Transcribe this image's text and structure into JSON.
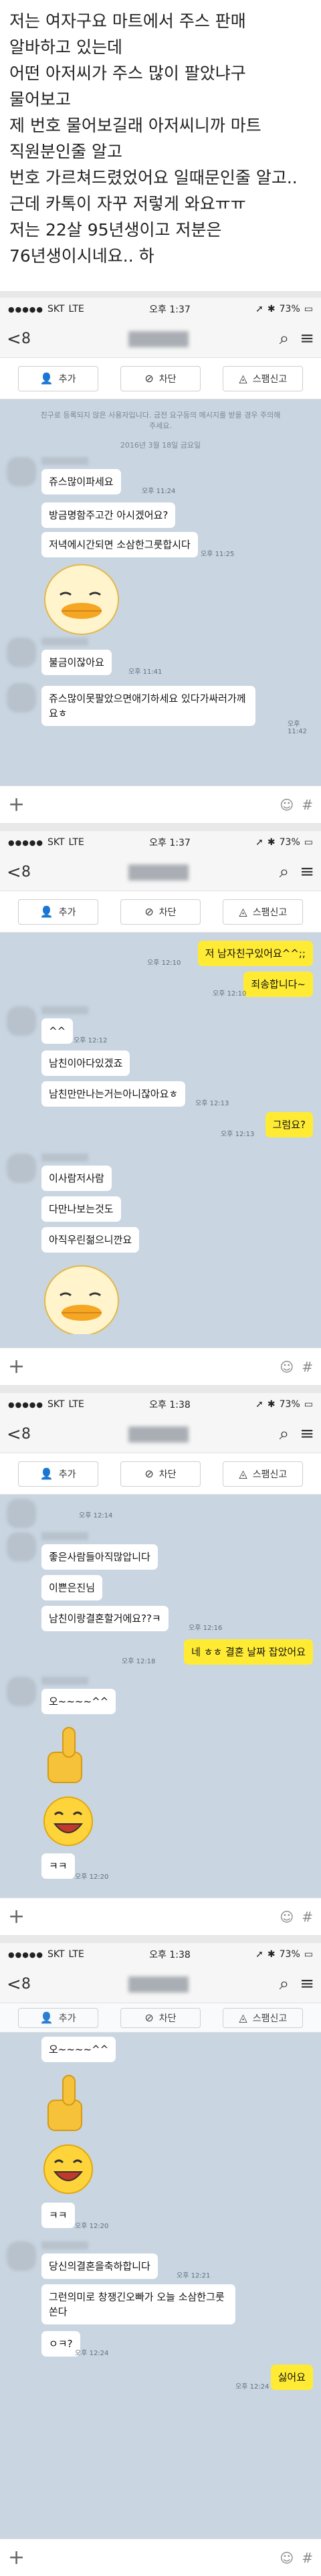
{
  "intro": {
    "lines": [
      "저는 여자구요 마트에서 주스 판매 알바하고 있는데",
      "어떤 아저씨가 주스 많이 팔았냐구 물어보고",
      "제 번호 물어보길래 아저씨니까 마트 직원분인줄 알고",
      "번호 가르쳐드렸었어요 일때문인줄 알고..",
      "근데 카톡이 자꾸 저렇게 와요ㅠㅠ",
      "저는 22살 95년생이고 저분은 76년생이시네요.. 하"
    ]
  },
  "common": {
    "carrier": "SKT",
    "network": "LTE",
    "battery": "73%",
    "back": "<",
    "count": "8",
    "add": "추가",
    "block": "차단",
    "report": "스팸신고"
  },
  "shots": [
    {
      "time": "오후 1:37",
      "notice": "친구로 등록되지 않은 사용자입니다. 금전 요구등의 메시지를 받을 경우 주의해 주세요.",
      "date": "2016년 3월 18일 금요일",
      "messages": [
        {
          "text": "쥬스많이파세요",
          "time": "오후 11:24"
        },
        {
          "text": "방금명함주고간 아시겠어요?",
          "time": ""
        },
        {
          "text": "저녁에시간되면 소삼한그룻합시다",
          "time": "오후 11:25"
        },
        {
          "text": "불금이잖아요",
          "time": "오후 11:41"
        },
        {
          "text": "쥬스많이못팔았으면애기하세요 있다가싸러가께요ㅎ",
          "time": "오후 11:42"
        }
      ]
    },
    {
      "time": "오후 1:37",
      "messages": [
        {
          "text": "저 남자친구있어요^^;;",
          "time": "오후 12:10",
          "me": true
        },
        {
          "text": "죄송합니다~",
          "time": "오후 12:10",
          "me": true
        },
        {
          "text": "^^",
          "time": "오후 12:12"
        },
        {
          "text": "남친이아다있겠죠",
          "time": ""
        },
        {
          "text": "남친만만나는거는아니잖아요ㅎ",
          "time": "오후 12:13"
        },
        {
          "text": "그럼요?",
          "time": "오후 12:13",
          "me": true
        },
        {
          "text": "이사람저사람",
          "time": ""
        },
        {
          "text": "다만나보는것도",
          "time": ""
        },
        {
          "text": "아직우린젊으니깐요",
          "time": ""
        }
      ]
    },
    {
      "time": "오후 1:38",
      "messages": [
        {
          "text": "좋은사람들아직많압니다",
          "time": "오후 12:14"
        },
        {
          "text": "이쁜은진님",
          "time": ""
        },
        {
          "text": "남친이랑결혼할거에요??ㅋ",
          "time": "오후 12:16"
        },
        {
          "text": "네 ㅎㅎ 결혼 날짜 잡았어요",
          "time": "오후 12:18",
          "me": true
        },
        {
          "text": "오~~~~^^",
          "time": ""
        },
        {
          "text": "ㅋㅋ",
          "time": "오후 12:20"
        }
      ]
    },
    {
      "time": "오후 1:38",
      "messages": [
        {
          "text": "오~~~~^^",
          "time": ""
        },
        {
          "text": "ㅋㅋ",
          "time": "오후 12:20"
        },
        {
          "text": "당신의결혼을축하합니다",
          "time": "오후 12:21"
        },
        {
          "text": "그런의미로 창쟁긴오빠가 오늘 소삼한그룻쏜다",
          "time": ""
        },
        {
          "text": "ㅇㅋ?",
          "time": "오후 12:24"
        },
        {
          "text": "싫어요",
          "time": "오후 12:24",
          "me": true
        }
      ]
    }
  ]
}
